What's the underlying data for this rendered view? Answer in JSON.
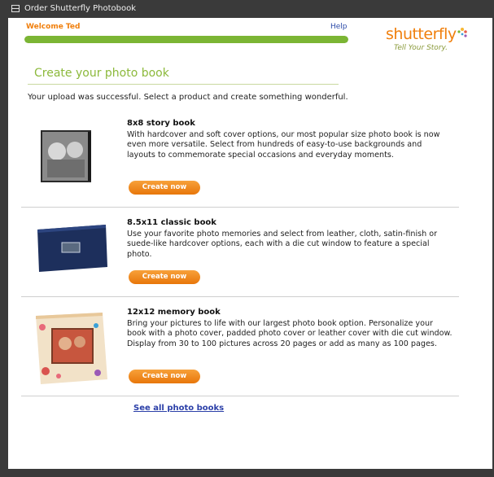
{
  "window": {
    "title": "Order Shutterfly Photobook"
  },
  "header": {
    "welcome": "Welcome Ted",
    "help": "Help",
    "progress": 1.0,
    "logo_text": "shutterfly",
    "logo_tagline": "Tell Your Story."
  },
  "main": {
    "title": "Create your photo book",
    "intro": "Your upload was successful. Select a product and create something wonderful.",
    "products": [
      {
        "name": "8x8 story book",
        "description": "With hardcover and soft cover options, our most popular size photo book is now even more versatile. Select from hundreds of easy-to-use backgrounds and layouts to commemorate special occasions and everyday moments.",
        "button": "Create now"
      },
      {
        "name": "8.5x11 classic book",
        "description": "Use your favorite photo memories and select from leather, cloth, satin-finish or suede-like hardcover options, each with a die cut window to feature a special photo.",
        "button": "Create now"
      },
      {
        "name": "12x12 memory book",
        "description": "Bring your pictures to life with our largest photo book option. Personalize your book with a photo cover, padded photo cover or leather cover with die cut window. Display from 30 to 100 pictures across 20 pages or add as many as 100 pages.",
        "button": "Create now"
      }
    ],
    "see_all": "See all photo books"
  },
  "colors": {
    "accent_orange": "#f07f0c",
    "accent_green": "#7bb534",
    "link_blue": "#2b3fa8",
    "titlebar": "#3a3a3a"
  }
}
